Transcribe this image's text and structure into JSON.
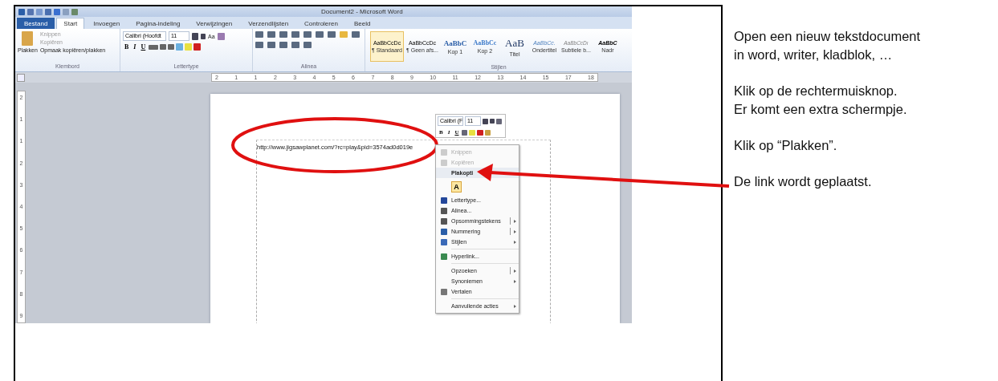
{
  "window": {
    "title": "Document2 - Microsoft Word"
  },
  "ribbon_tabs": [
    {
      "label": "Bestand",
      "selected": false,
      "kind": "file"
    },
    {
      "label": "Start",
      "selected": true,
      "kind": "tab"
    },
    {
      "label": "Invoegen",
      "selected": false,
      "kind": "tab"
    },
    {
      "label": "Pagina-indeling",
      "selected": false,
      "kind": "tab"
    },
    {
      "label": "Verwijzingen",
      "selected": false,
      "kind": "tab"
    },
    {
      "label": "Verzendlijsten",
      "selected": false,
      "kind": "tab"
    },
    {
      "label": "Controleren",
      "selected": false,
      "kind": "tab"
    },
    {
      "label": "Beeld",
      "selected": false,
      "kind": "tab"
    }
  ],
  "clipboard": {
    "group": "Klembord",
    "paste": "Plakken",
    "items": [
      {
        "label": "Knippen",
        "disabled": true
      },
      {
        "label": "Kopiëren",
        "disabled": true
      },
      {
        "label": "Opmaak kopiëren/plakken",
        "disabled": false
      }
    ]
  },
  "font": {
    "group": "Lettertype",
    "name": "Calibri (Hoofdt",
    "size": "11",
    "change_case": "Aa",
    "format_buttons": [
      "B",
      "I",
      "U"
    ]
  },
  "paragraph": {
    "group": "Alinea"
  },
  "styles": {
    "group": "Stijlen",
    "items": [
      {
        "sample": "AaBbCcDc",
        "label": "¶ Standaard",
        "kind": "normal",
        "selected": true
      },
      {
        "sample": "AaBbCcDc",
        "label": "¶ Geen afs...",
        "kind": "normal",
        "selected": false
      },
      {
        "sample": "AaBbC",
        "label": "Kop 1",
        "kind": "heading",
        "selected": false
      },
      {
        "sample": "AaBbCc",
        "label": "Kop 2",
        "kind": "heading2",
        "selected": false
      },
      {
        "sample": "AaB",
        "label": "Titel",
        "kind": "title",
        "selected": false
      },
      {
        "sample": "AaBbCc.",
        "label": "Ondertitel",
        "kind": "subtitle",
        "selected": false
      },
      {
        "sample": "AaBbCcDı",
        "label": "Subtiele b...",
        "kind": "subtle",
        "selected": false
      },
      {
        "sample": "AaBbC",
        "label": "Nadr",
        "kind": "emphasis",
        "selected": false
      }
    ]
  },
  "document": {
    "text": "http://www.jigsawplanet.com/?rc=play&pid=3574ad0d019e"
  },
  "mini_toolbar": {
    "font": "Calibri (F",
    "size": "11",
    "format_buttons": [
      "B",
      "I",
      "U"
    ]
  },
  "horizontal_ruler": [
    "2",
    "1",
    "1",
    "2",
    "3",
    "4",
    "5",
    "6",
    "7",
    "8",
    "9",
    "10",
    "11",
    "12",
    "13",
    "14",
    "15",
    "17",
    "18"
  ],
  "vertical_ruler": [
    "2",
    "1",
    "1",
    "2",
    "3",
    "4",
    "5",
    "6",
    "7",
    "8",
    "9"
  ],
  "context_menu": [
    {
      "kind": "item",
      "label": "Knippen",
      "disabled": true,
      "has_submenu": false,
      "split": false
    },
    {
      "kind": "item",
      "label": "Kopiëren",
      "disabled": true,
      "has_submenu": false,
      "split": false
    },
    {
      "kind": "header",
      "label": "Plakopti"
    },
    {
      "kind": "paste_option",
      "label": "A"
    },
    {
      "kind": "item",
      "label": "Lettertype...",
      "disabled": false,
      "has_submenu": false,
      "split": false
    },
    {
      "kind": "item",
      "label": "Alinea...",
      "disabled": false,
      "has_submenu": false,
      "split": false
    },
    {
      "kind": "item",
      "label": "Opsommingstekens",
      "disabled": false,
      "has_submenu": true,
      "split": true
    },
    {
      "kind": "item",
      "label": "Nummering",
      "disabled": false,
      "has_submenu": true,
      "split": true
    },
    {
      "kind": "item",
      "label": "Stijlen",
      "disabled": false,
      "has_submenu": true,
      "split": false
    },
    {
      "kind": "separator"
    },
    {
      "kind": "item",
      "label": "Hyperlink...",
      "disabled": false,
      "has_submenu": false,
      "split": false
    },
    {
      "kind": "separator"
    },
    {
      "kind": "item",
      "label": "Opzoeken",
      "disabled": false,
      "has_submenu": true,
      "split": true
    },
    {
      "kind": "item",
      "label": "Synoniemen",
      "disabled": false,
      "has_submenu": true,
      "split": false
    },
    {
      "kind": "item",
      "label": "Vertalen",
      "disabled": false,
      "has_submenu": false,
      "split": false
    },
    {
      "kind": "separator"
    },
    {
      "kind": "item",
      "label": "Aanvullende acties",
      "disabled": false,
      "has_submenu": true,
      "split": false
    }
  ],
  "instructions": [
    "Open een nieuw tekstdocument\nin word, writer, kladblok, …",
    "Klik op de rechtermuisknop.\nEr komt een extra schermpje.",
    "Klik op “Plakken”.",
    "De link wordt geplaatst."
  ]
}
